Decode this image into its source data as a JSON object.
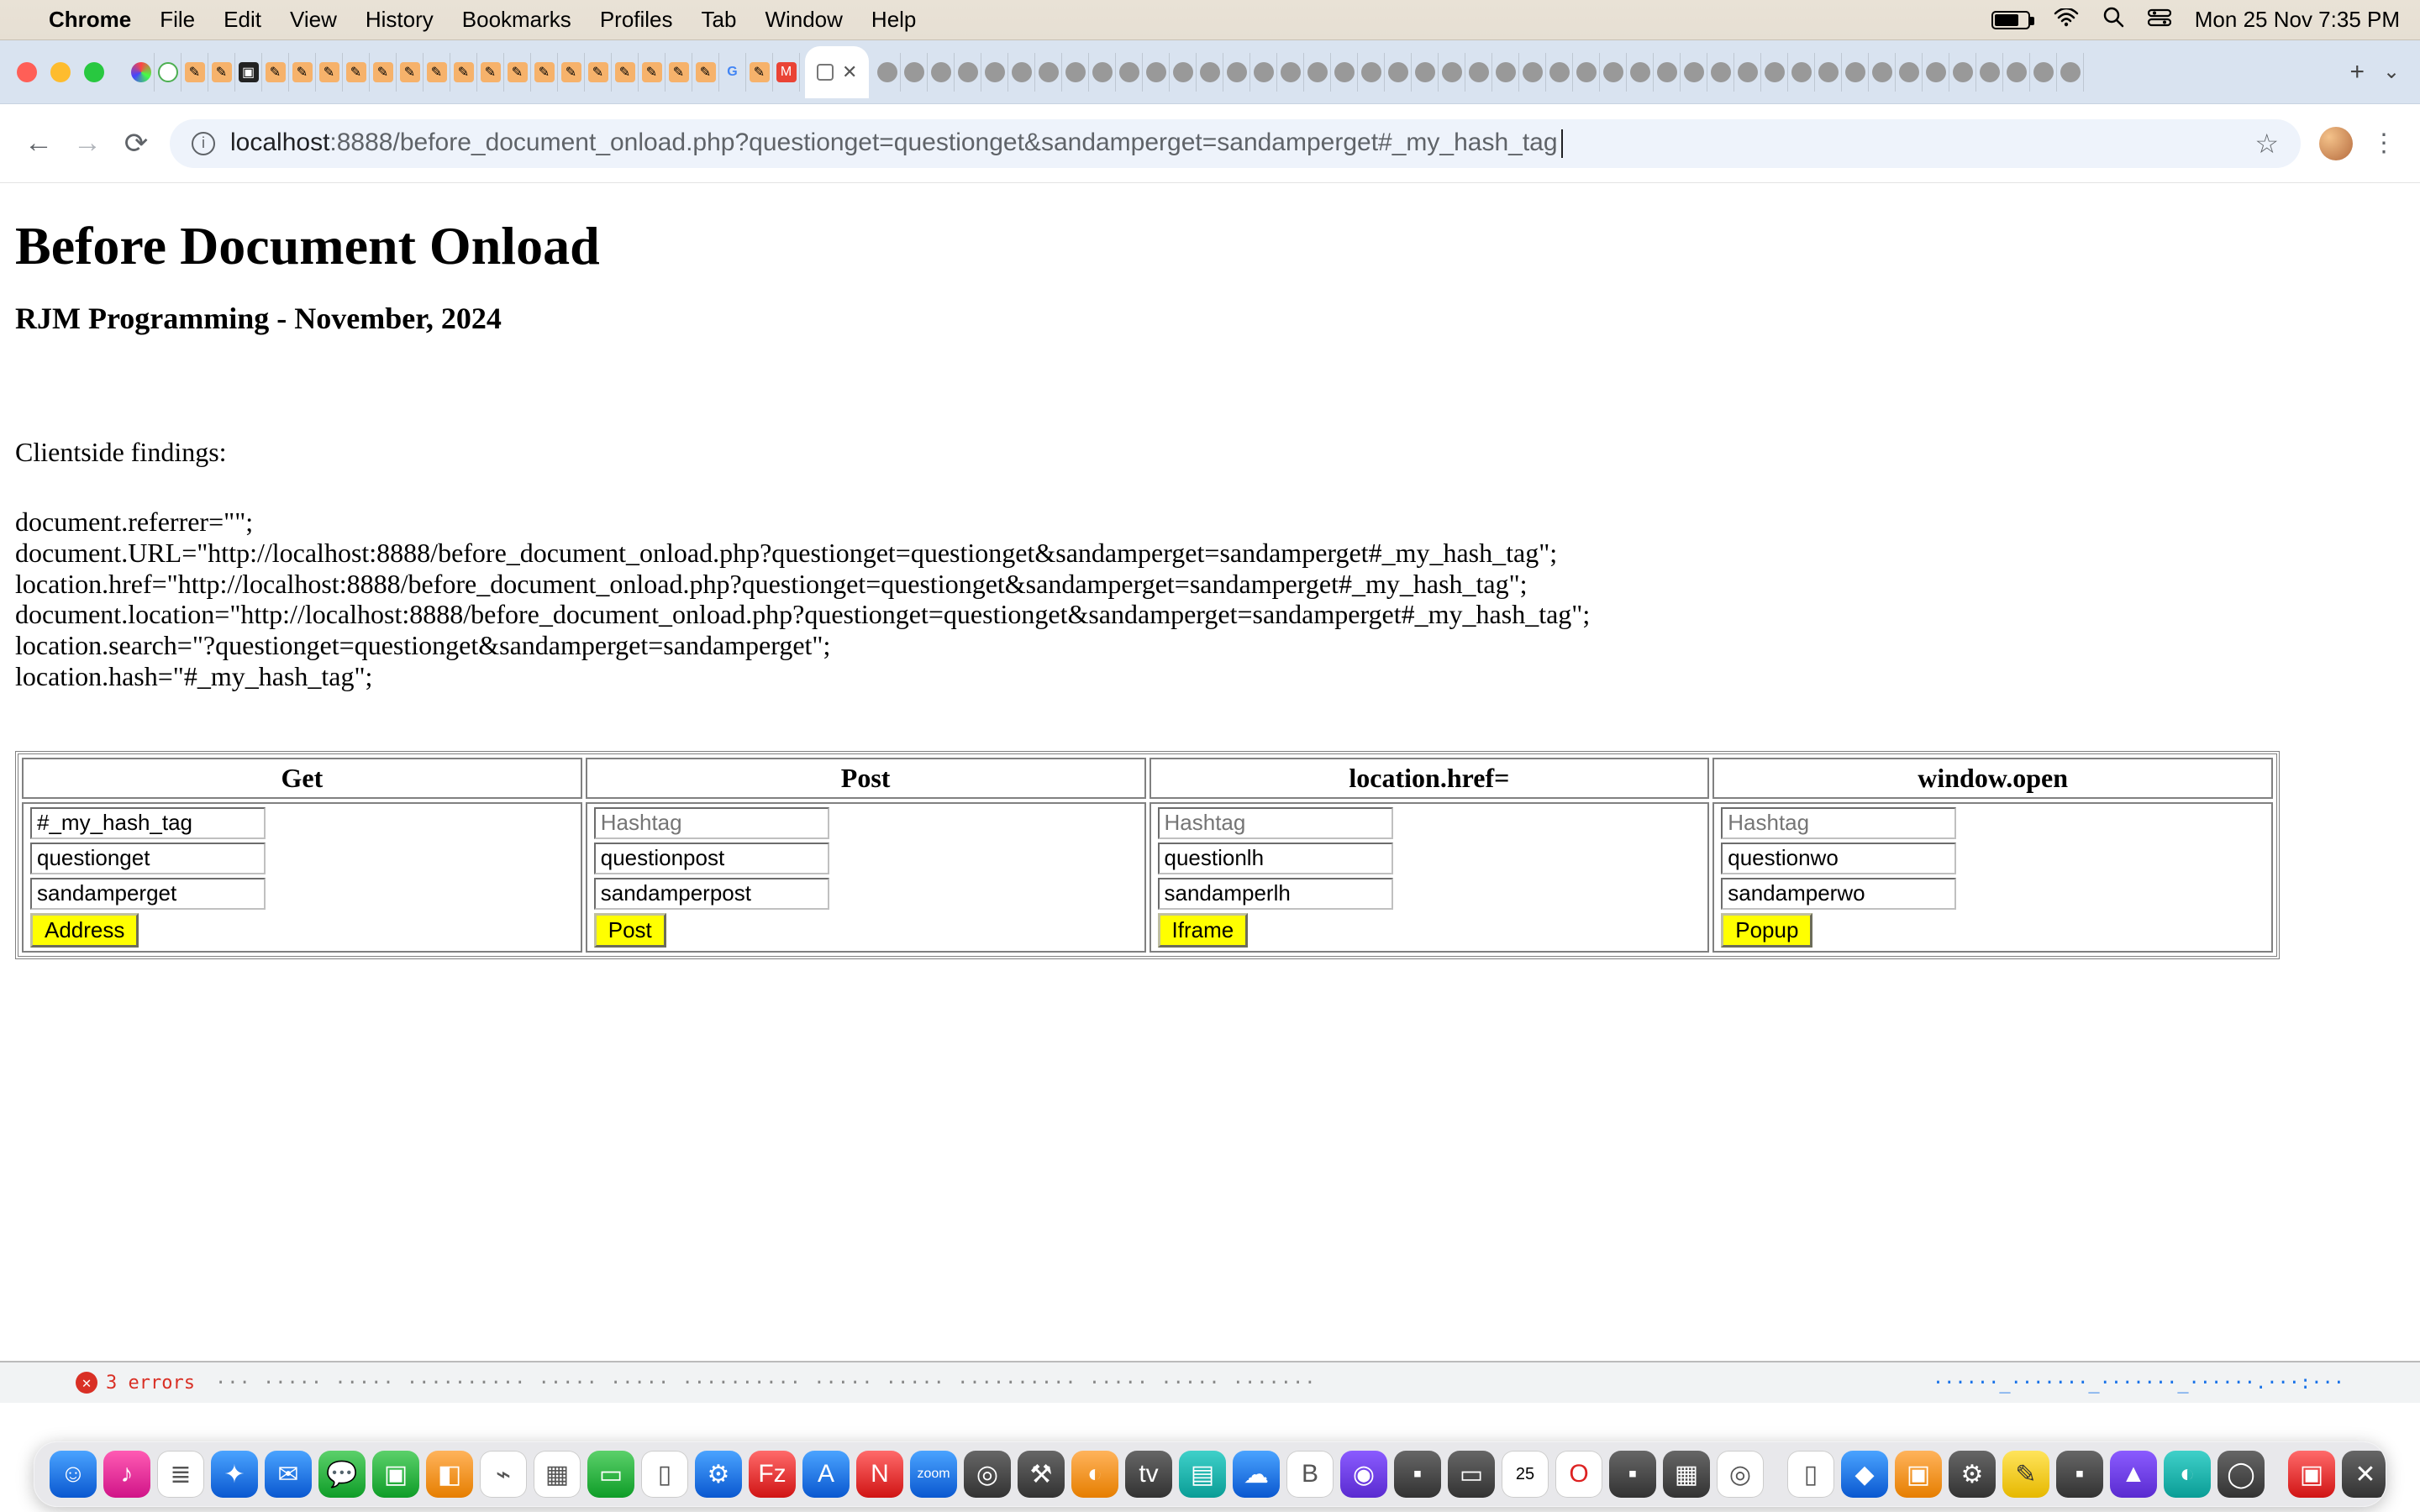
{
  "menubar": {
    "app": "Chrome",
    "items": [
      "File",
      "Edit",
      "View",
      "History",
      "Bookmarks",
      "Profiles",
      "Tab",
      "Window",
      "Help"
    ],
    "clock": "Mon 25 Nov  7:35 PM"
  },
  "toolbar": {
    "url_host": "localhost",
    "url_port": ":8888",
    "url_path": "/before_document_onload.php?questionget=questionget&sandamperget=sandamperget#_my_hash_tag"
  },
  "page": {
    "h1": "Before Document Onload",
    "h3": "RJM Programming - November, 2024",
    "findings_label": "Clientside findings:",
    "findings": "document.referrer=\"\";\ndocument.URL=\"http://localhost:8888/before_document_onload.php?questionget=questionget&sandamperget=sandamperget#_my_hash_tag\";\nlocation.href=\"http://localhost:8888/before_document_onload.php?questionget=questionget&sandamperget=sandamperget#_my_hash_tag\";\ndocument.location=\"http://localhost:8888/before_document_onload.php?questionget=questionget&sandamperget=sandamperget#_my_hash_tag\";\nlocation.search=\"?questionget=questionget&sandamperget=sandamperget\";\nlocation.hash=\"#_my_hash_tag\";"
  },
  "table": {
    "headers": [
      "Get",
      "Post",
      "location.href=",
      "window.open"
    ],
    "cols": [
      {
        "hashtag": "#_my_hash_tag",
        "q": "questionget",
        "s": "sandamperget",
        "btn": "Address"
      },
      {
        "hashtag": "Hashtag",
        "q": "questionpost",
        "s": "sandamperpost",
        "btn": "Post"
      },
      {
        "hashtag": "Hashtag",
        "q": "questionlh",
        "s": "sandamperlh",
        "btn": "Iframe"
      },
      {
        "hashtag": "Hashtag",
        "q": "questionwo",
        "s": "sandamperwo",
        "btn": "Popup"
      }
    ]
  },
  "devtools": {
    "errors": "3 errors"
  }
}
